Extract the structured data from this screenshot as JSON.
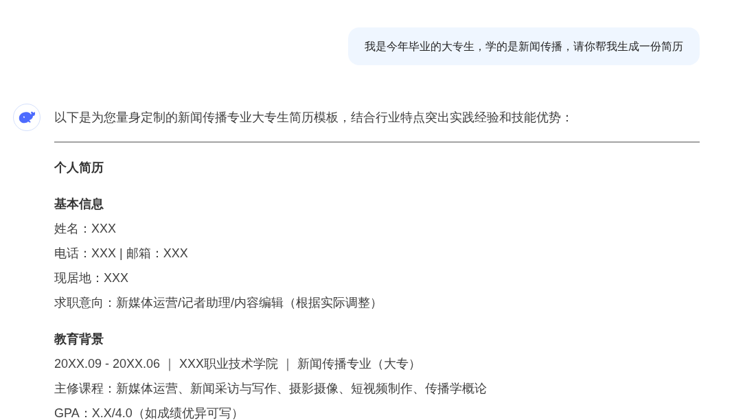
{
  "user_message": "我是今年毕业的大专生，学的是新闻传播，请你帮我生成一份简历",
  "reply": {
    "intro": "以下是为您量身定制的新闻传播专业大专生简历模板，结合行业特点突出实践经验和技能优势：",
    "title": "个人简历",
    "sections": [
      {
        "heading": "基本信息",
        "lines": [
          "姓名：XXX",
          "电话：XXX | 邮箱：XXX",
          "现居地：XXX",
          "求职意向：新媒体运营/记者助理/内容编辑（根据实际调整）"
        ]
      },
      {
        "heading": "教育背景",
        "lines": [
          "20XX.09 - 20XX.06 ｜ XXX职业技术学院 ｜ 新闻传播专业（大专）",
          "主修课程：新媒体运营、新闻采访与写作、摄影摄像、短视频制作、传播学概论",
          "GPA：X.X/4.0（如成绩优异可写）"
        ]
      }
    ]
  }
}
